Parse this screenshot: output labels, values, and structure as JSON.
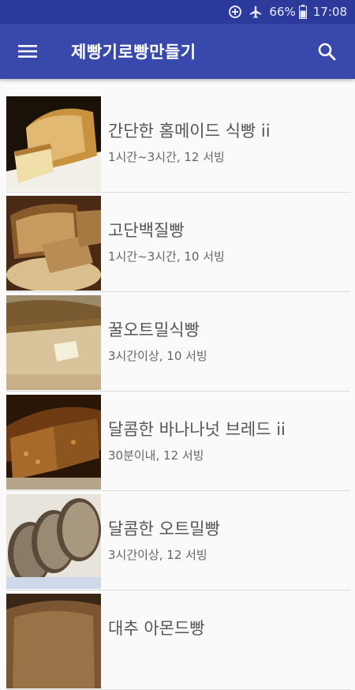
{
  "status": {
    "battery": "66%",
    "time": "17:08"
  },
  "appbar": {
    "title": "제빵기로빵만들기"
  },
  "recipes": [
    {
      "name": "간단한 홈메이드 식빵 ii",
      "meta": "1시간~3시간, 12 서빙"
    },
    {
      "name": "고단백질빵",
      "meta": "1시간~3시간, 10 서빙"
    },
    {
      "name": "꿀오트밀식빵",
      "meta": "3시간이상, 10 서빙"
    },
    {
      "name": "달콤한 바나나넛 브레드 ii",
      "meta": "30분이내, 12 서빙"
    },
    {
      "name": "달콤한 오트밀빵",
      "meta": "3시간이상, 12 서빙"
    },
    {
      "name": "대추 아몬드빵",
      "meta": ""
    }
  ],
  "colors": {
    "appbar": "#3949ab",
    "statusbar": "#2c3a9c",
    "background": "#fafafa"
  },
  "icons": {
    "menu": "menu-icon",
    "search": "search-icon",
    "data_saver": "data-saver-icon",
    "airplane": "airplane-icon",
    "battery": "battery-icon"
  }
}
